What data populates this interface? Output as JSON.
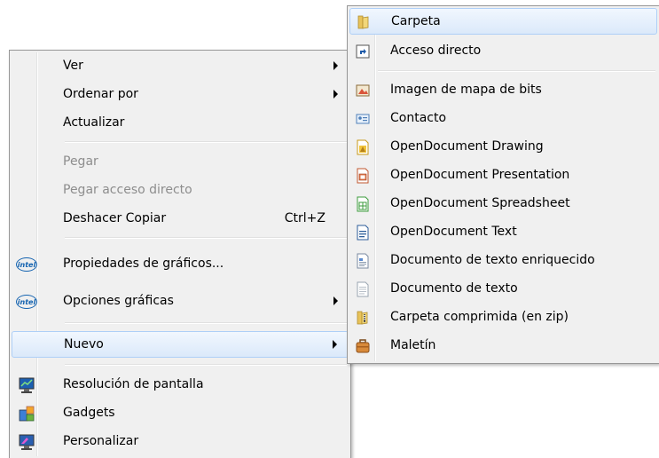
{
  "context_menu": {
    "items": [
      {
        "label": "Ver",
        "submenu": true
      },
      {
        "label": "Ordenar por",
        "submenu": true
      },
      {
        "label": "Actualizar"
      },
      {
        "label": "Pegar",
        "disabled": true
      },
      {
        "label": "Pegar acceso directo",
        "disabled": true
      },
      {
        "label": "Deshacer Copiar",
        "shortcut": "Ctrl+Z"
      },
      {
        "label": "Propiedades de gráficos...",
        "icon": "intel-icon",
        "icon_text": "intel"
      },
      {
        "label": "Opciones gráficas",
        "icon": "intel-icon",
        "icon_text": "intel",
        "submenu": true
      },
      {
        "label": "Nuevo",
        "submenu": true,
        "highlighted": true
      },
      {
        "label": "Resolución de pantalla",
        "icon": "monitor-icon"
      },
      {
        "label": "Gadgets",
        "icon": "gadgets-icon"
      },
      {
        "label": "Personalizar",
        "icon": "personalize-icon"
      }
    ]
  },
  "submenu_nuevo": {
    "items": [
      {
        "label": "Carpeta",
        "icon": "folder-icon",
        "highlighted": true
      },
      {
        "label": "Acceso directo",
        "icon": "shortcut-icon"
      },
      {
        "label": "Imagen de mapa de bits",
        "icon": "bitmap-icon"
      },
      {
        "label": "Contacto",
        "icon": "contact-icon"
      },
      {
        "label": "OpenDocument Drawing",
        "icon": "odg-icon"
      },
      {
        "label": "OpenDocument Presentation",
        "icon": "odp-icon"
      },
      {
        "label": "OpenDocument Spreadsheet",
        "icon": "ods-icon"
      },
      {
        "label": "OpenDocument Text",
        "icon": "odt-icon"
      },
      {
        "label": "Documento de texto enriquecido",
        "icon": "rtf-icon"
      },
      {
        "label": "Documento de texto",
        "icon": "txt-icon"
      },
      {
        "label": "Carpeta comprimida (en zip)",
        "icon": "zip-folder-icon"
      },
      {
        "label": "Maletín",
        "icon": "briefcase-icon"
      }
    ]
  },
  "colors": {
    "highlight": "#dbe9fa",
    "highlight_border": "#aecff7",
    "disabled_text": "#8d8d8d",
    "menu_bg": "#f0f0f0"
  }
}
